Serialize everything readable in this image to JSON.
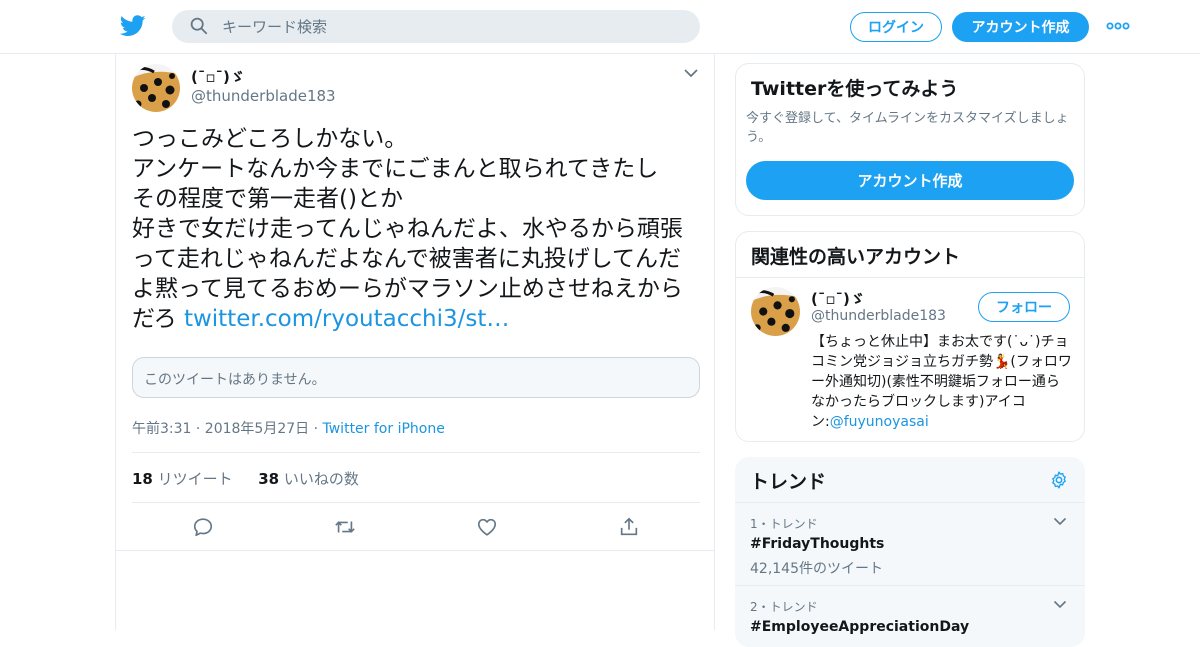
{
  "header": {
    "logo_icon": "twitter-bird-icon",
    "search_placeholder": "キーワード検索",
    "login_label": "ログイン",
    "signup_label": "アカウント作成",
    "more_icon": "more-dots-icon",
    "brand_color": "#1da1f2"
  },
  "tweet": {
    "author_name": "(¯▫¯)ゞ",
    "author_handle": "@thunderblade183",
    "text": "つっこみどころしかない。\nアンケートなんか今までにごまんと取られてきたし\nその程度で第一走者()とか\n好きで女だけ走ってんじゃねんだよ、水やるから頑張って走れじゃねんだよなんで被害者に丸投げしてんだよ黙って見てるおめーらがマラソン止めさせねえからだろ ",
    "link": "twitter.com/ryoutacchi3/st…",
    "quote_unavailable": "このツイートはありません。",
    "time": "午前3:31 · 2018年5月27日",
    "meta_separator": " · ",
    "source": "Twitter for iPhone",
    "retweet_count": "18",
    "retweet_label": "リツイート",
    "like_count": "38",
    "like_label": "いいねの数"
  },
  "sidebar": {
    "signup_card": {
      "title": "Twitterを使ってみよう",
      "description": "今すぐ登録して、タイムラインをカスタマイズしましょう。",
      "button_label": "アカウント作成"
    },
    "related": {
      "title": "関連性の高いアカウント",
      "name": "(¯▫¯)ゞ",
      "handle": "@thunderblade183",
      "follow_label": "フォロー",
      "bio": "【ちょっと休止中】まお太です(˙ᴗ˙)チョコミン党ジョジョ立ちガチ勢💃(フォロワー外通知切)(素性不明鍵垢フォロー通らなかったらブロックします)アイコン:",
      "bio_link": "@fuyunoyasai"
    },
    "trends": {
      "title": "トレンド",
      "items": [
        {
          "rank": "1・トレンド",
          "name": "#FridayThoughts",
          "count": "42,145件のツイート"
        },
        {
          "rank": "2・トレンド",
          "name": "#EmployeeAppreciationDay",
          "count": ""
        }
      ]
    }
  }
}
